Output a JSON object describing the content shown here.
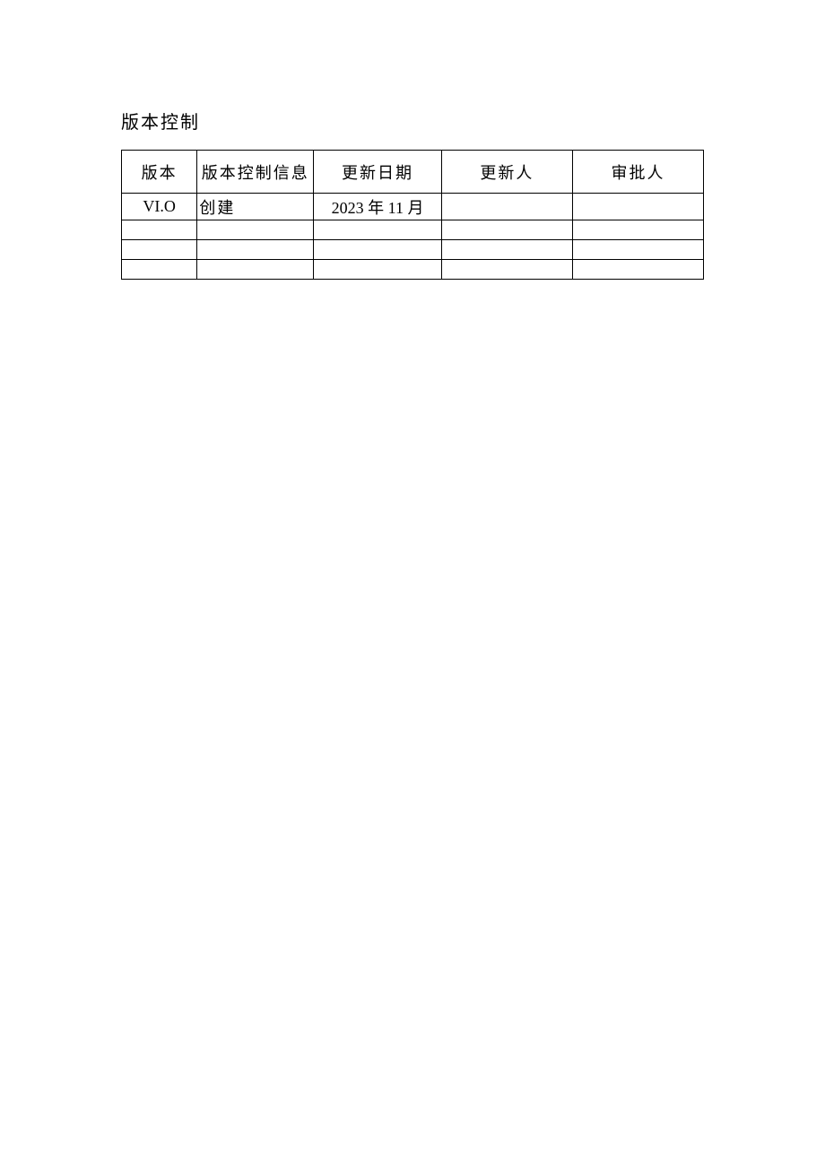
{
  "title": "版本控制",
  "headers": {
    "col1": "版本",
    "col2": "版本控制信息",
    "col3": "更新日期",
    "col4": "更新人",
    "col5": "审批人"
  },
  "rows": [
    {
      "c1": "VI.O",
      "c2": "创建",
      "c3": "2023 年 11 月",
      "c4": "",
      "c5": ""
    },
    {
      "c1": "",
      "c2": "",
      "c3": "",
      "c4": "",
      "c5": ""
    },
    {
      "c1": "",
      "c2": "",
      "c3": "",
      "c4": "",
      "c5": ""
    },
    {
      "c1": "",
      "c2": "",
      "c3": "",
      "c4": "",
      "c5": ""
    }
  ]
}
